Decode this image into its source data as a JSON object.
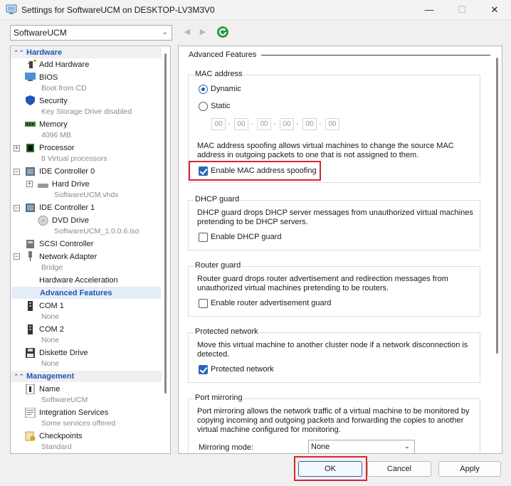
{
  "window": {
    "title": "Settings for SoftwareUCM on DESKTOP-LV3M3V0",
    "minimize": "—",
    "maximize": "☐",
    "close": "✕"
  },
  "toolbar": {
    "vm_selected": "SoftwareUCM",
    "back": "◀",
    "forward": "▶"
  },
  "tree": {
    "hardware_header": "Hardware",
    "management_header": "Management",
    "hardware": [
      {
        "label": "Add Hardware",
        "sub": ""
      },
      {
        "label": "BIOS",
        "sub": "Boot from CD"
      },
      {
        "label": "Security",
        "sub": "Key Storage Drive disabled"
      },
      {
        "label": "Memory",
        "sub": "4096 MB"
      },
      {
        "label": "Processor",
        "sub": "8 Virtual processors"
      },
      {
        "label": "IDE Controller 0",
        "sub": ""
      },
      {
        "label": "Hard Drive",
        "sub": "SoftwareUCM.vhdx"
      },
      {
        "label": "IDE Controller 1",
        "sub": ""
      },
      {
        "label": "DVD Drive",
        "sub": "SoftwareUCM_1.0.0.6.iso"
      },
      {
        "label": "SCSI Controller",
        "sub": ""
      },
      {
        "label": "Network Adapter",
        "sub": "Bridge"
      },
      {
        "label": "Hardware Acceleration",
        "sub": ""
      },
      {
        "label": "Advanced Features",
        "sub": ""
      },
      {
        "label": "COM 1",
        "sub": "None"
      },
      {
        "label": "COM 2",
        "sub": "None"
      },
      {
        "label": "Diskette Drive",
        "sub": "None"
      }
    ],
    "management": [
      {
        "label": "Name",
        "sub": "SoftwareUCM"
      },
      {
        "label": "Integration Services",
        "sub": "Some services offered"
      },
      {
        "label": "Checkpoints",
        "sub": "Standard"
      }
    ]
  },
  "panel": {
    "title": "Advanced Features",
    "mac": {
      "title": "MAC address",
      "dynamic_label": "Dynamic",
      "dynamic_selected": true,
      "static_label": "Static",
      "octets": [
        "00",
        "00",
        "00",
        "00",
        "00",
        "00"
      ],
      "separator": "-",
      "spoof_desc_1": "MAC address spoofing allows virtual machines to change the source MAC",
      "spoof_desc_2": "address in outgoing packets to one that is not assigned to them.",
      "spoof_label": "Enable MAC address spoofing",
      "spoof_checked": true
    },
    "dhcp": {
      "title": "DHCP guard",
      "desc_1": "DHCP guard drops DHCP server messages from unauthorized virtual machines",
      "desc_2": "pretending to be DHCP servers.",
      "label": "Enable DHCP guard",
      "checked": false
    },
    "router": {
      "title": "Router guard",
      "desc_1": "Router guard drops router advertisement and redirection messages from",
      "desc_2": "unauthorized virtual machines pretending to be routers.",
      "label": "Enable router advertisement guard",
      "checked": false
    },
    "protected": {
      "title": "Protected network",
      "desc_1": "Move this virtual machine to another cluster node if a network disconnection is",
      "desc_2": "detected.",
      "label": "Protected network",
      "checked": true
    },
    "mirroring": {
      "title": "Port mirroring",
      "desc_1": "Port mirroring allows the network traffic of a virtual machine to be monitored by",
      "desc_2": "copying incoming and outgoing packets and forwarding the copies to another",
      "desc_3": "virtual machine configured for monitoring.",
      "mode_label": "Mirroring mode:",
      "mode_value": "None"
    }
  },
  "buttons": {
    "ok": "OK",
    "cancel": "Cancel",
    "apply": "Apply"
  },
  "colors": {
    "accent": "#1f57b5",
    "highlight_box": "#d7262f"
  }
}
